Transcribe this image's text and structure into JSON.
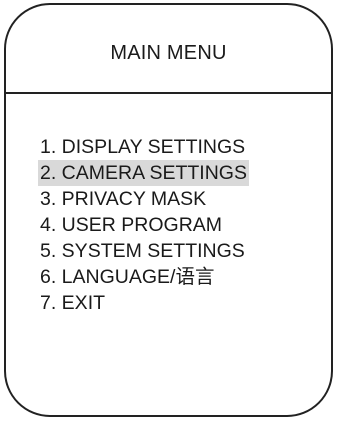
{
  "menu": {
    "title": "MAIN MENU",
    "selected_index": 1,
    "highlight_color": "#d9d9d9",
    "items": [
      {
        "label": "1. DISPLAY SETTINGS"
      },
      {
        "label": "2. CAMERA SETTINGS"
      },
      {
        "label": "3. PRIVACY MASK"
      },
      {
        "label": "4. USER PROGRAM"
      },
      {
        "label": "5. SYSTEM SETTINGS"
      },
      {
        "label": "6. LANGUAGE/语言"
      },
      {
        "label": "7. EXIT"
      }
    ]
  }
}
